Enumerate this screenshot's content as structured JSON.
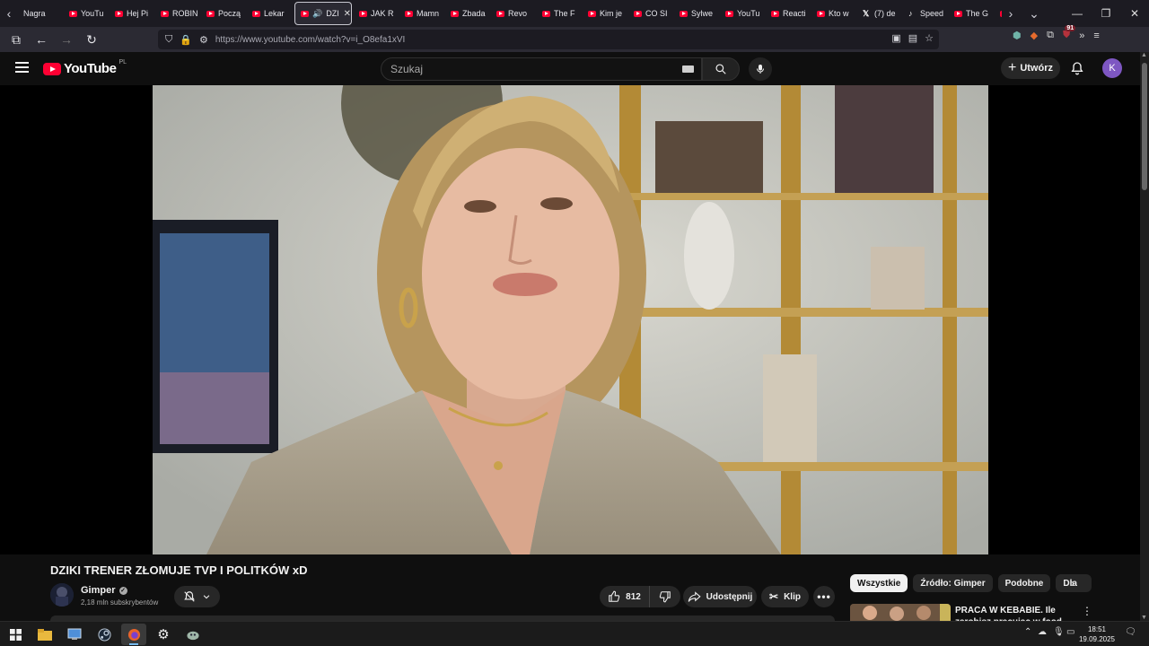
{
  "browser": {
    "tabs": [
      {
        "label": "Nagra",
        "icon": "none"
      },
      {
        "label": "YouTu",
        "icon": "youtube"
      },
      {
        "label": "Hej Pi",
        "icon": "youtube"
      },
      {
        "label": "ROBIN",
        "icon": "youtube"
      },
      {
        "label": "Począ",
        "icon": "youtube"
      },
      {
        "label": "Lekar",
        "icon": "youtube"
      },
      {
        "label": "DZI",
        "icon": "youtube",
        "active": true,
        "playing": true
      },
      {
        "label": "JAK R",
        "icon": "youtube"
      },
      {
        "label": "Mamn",
        "icon": "youtube"
      },
      {
        "label": "Zbada",
        "icon": "youtube"
      },
      {
        "label": "Revo",
        "icon": "youtube"
      },
      {
        "label": "The F",
        "icon": "youtube"
      },
      {
        "label": "Kim je",
        "icon": "youtube"
      },
      {
        "label": "CO SI",
        "icon": "youtube"
      },
      {
        "label": "Sylwe",
        "icon": "youtube"
      },
      {
        "label": "YouTu",
        "icon": "youtube"
      },
      {
        "label": "Reacti",
        "icon": "youtube"
      },
      {
        "label": "Kto w",
        "icon": "youtube"
      },
      {
        "label": "(7) de",
        "icon": "x"
      },
      {
        "label": "Speed",
        "icon": "tiktok"
      },
      {
        "label": "The G",
        "icon": "youtube"
      }
    ],
    "url": "https://www.youtube.com/watch?v=i_O8efa1xVI",
    "ext_badge": "91"
  },
  "youtube": {
    "logo_text": "YouTube",
    "region": "PL",
    "search_placeholder": "Szukaj",
    "create_label": "Utwórz",
    "avatar_letter": "K"
  },
  "video": {
    "title": "DZIKI TRENER ZŁOMUJE TVP I POLITKÓW xD",
    "channel": "Gimper",
    "subscribers": "2,18 mln subskrybentów",
    "likes": "812",
    "share_label": "Udostępnij",
    "clip_label": "Klip"
  },
  "sidebar": {
    "chips": [
      "Wszystkie",
      "Źródło: Gimper",
      "Podobne",
      "Dla"
    ],
    "recommendation_title": "PRACA W KEBABIE. Ile zarobisz pracując w food trucku? | DO"
  },
  "taskbar": {
    "time": "18:51",
    "date": "19.09.2025"
  },
  "colors": {
    "accent_red": "#ff0033",
    "avatar_purple": "#7e57c2",
    "page_bg": "#0f0f0f"
  }
}
